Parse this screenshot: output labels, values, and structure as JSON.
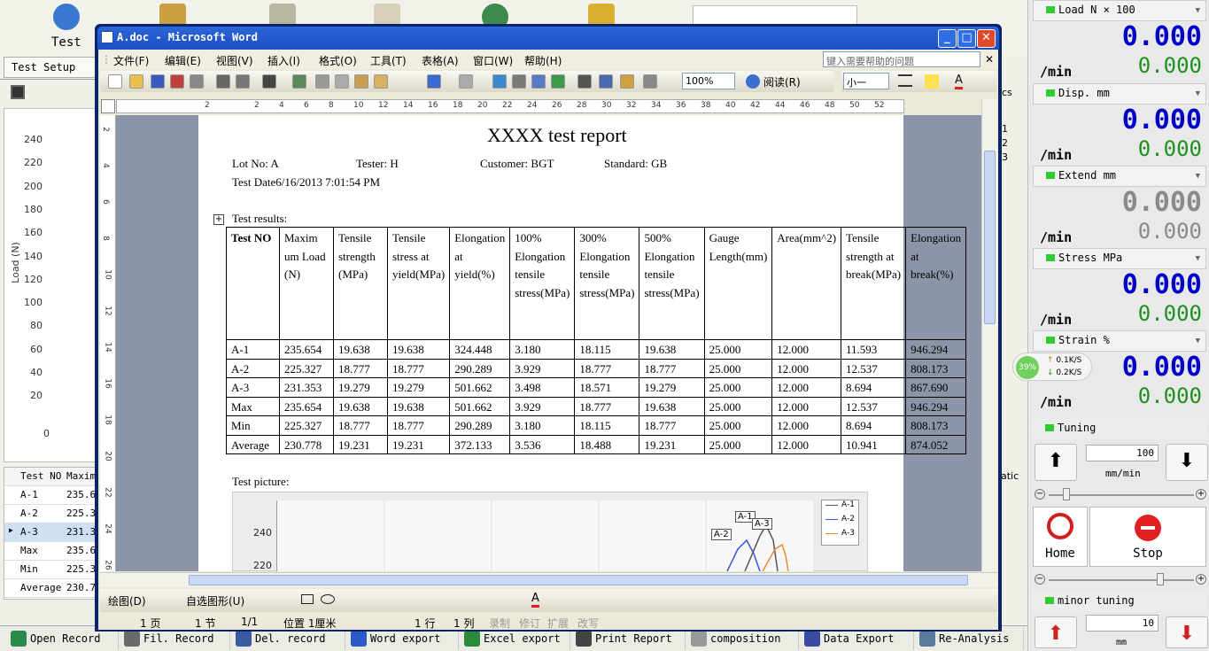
{
  "app": {
    "top_label": "Test",
    "tab_test_setup": "Test Setup",
    "chart_y_ticks": [
      "240",
      "220",
      "200",
      "180",
      "160",
      "140",
      "120",
      "100",
      "80",
      "60",
      "40",
      "20",
      "0"
    ],
    "chart_y_title": "Load (N)",
    "table_headers": [
      "Test NO",
      "Maxim"
    ],
    "table_rows": [
      {
        "no": "A-1",
        "val": "235.65"
      },
      {
        "no": "A-2",
        "val": "225.32"
      },
      {
        "no": "A-3",
        "val": "231.35"
      },
      {
        "no": "Max",
        "val": "235.65"
      },
      {
        "no": "Min",
        "val": "225.32"
      },
      {
        "no": "Average",
        "val": "230.77"
      }
    ],
    "side_numbers": [
      "1",
      "2",
      "3"
    ],
    "cs_text": "cs",
    "atic_text": "atic",
    "bottom_buttons": [
      "Open Record",
      "Fil. Record",
      "Del. record",
      "Word export",
      "Excel export",
      "Print Report",
      "composition",
      "Data Export",
      "Re-Analysis"
    ]
  },
  "right_panel": {
    "channels": [
      {
        "name": "Load N × 100",
        "value": "0.000",
        "rate_unit": "/min",
        "rate": "0.000",
        "active": true
      },
      {
        "name": "Disp. mm",
        "value": "0.000",
        "rate_unit": "/min",
        "rate": "0.000",
        "active": true
      },
      {
        "name": "Extend mm",
        "value": "0.000",
        "rate_unit": "/min",
        "rate": "0.000",
        "active": false
      },
      {
        "name": "Stress MPa",
        "value": "0.000",
        "rate_unit": "/min",
        "rate": "0.000",
        "active": true
      },
      {
        "name": "Strain %",
        "value": "0.000",
        "rate_unit": "/min",
        "rate": "0.000",
        "active": true
      }
    ],
    "tuning_label": "Tuning",
    "tuning_value": "100",
    "tuning_unit": "mm/min",
    "home_label": "Home",
    "stop_label": "Stop",
    "minor_tuning_label": "minor tuning",
    "minor_value": "10",
    "minor_unit": "mm",
    "net_badge": {
      "percent": "39%",
      "up": "0.1K/S",
      "down": "0.2K/S"
    }
  },
  "word": {
    "title": "A.doc - Microsoft Word",
    "menu": [
      "文件(F)",
      "编辑(E)",
      "视图(V)",
      "插入(I)",
      "格式(O)",
      "工具(T)",
      "表格(A)",
      "窗口(W)",
      "帮助(H)"
    ],
    "help_placeholder": "键入需要帮助的问题",
    "zoom": "100%",
    "read_label": "阅读(R)",
    "font_size": "小一",
    "ruler_numbers": [
      "2",
      "2",
      "4",
      "6",
      "8",
      "10",
      "12",
      "14",
      "16",
      "18",
      "20",
      "22",
      "24",
      "26",
      "28",
      "30",
      "32",
      "34",
      "36",
      "38",
      "40",
      "42",
      "44",
      "46",
      "48",
      "50",
      "52"
    ],
    "vruler_numbers": [
      "2",
      "4",
      "6",
      "8",
      "10",
      "12",
      "14",
      "16",
      "18",
      "20",
      "22",
      "24",
      "26"
    ],
    "status": {
      "page": "1 页",
      "section": "1 节",
      "pages": "1/1",
      "position": "位置 1厘米",
      "line": "1 行",
      "col": "1 列",
      "rec": "录制",
      "rev": "修订",
      "ext": "扩展",
      "ovr": "改写"
    },
    "draw_label": "绘图(D)",
    "autoshape_label": "自选图形(U)"
  },
  "doc": {
    "title": "XXXX test report",
    "lot": "Lot No: A",
    "tester": "Tester: H",
    "customer": "Customer: BGT",
    "standard": "Standard: GB",
    "test_date": "Test Date6/16/2013 7:01:54 PM",
    "results_label": "Test results:",
    "picture_label": "Test picture:",
    "table_headers": [
      "Test NO",
      "Maxim um Load (N)",
      "Tensile strength (MPa)",
      "Tensile stress at yield(MPa)",
      "Elongation at yield(%)",
      "100% Elongation tensile stress(MPa)",
      "300% Elongation tensile stress(MPa)",
      "500% Elongation tensile stress(MPa)",
      "Gauge Length(mm)",
      "Area(mm^2)",
      "Tensile strength at break(MPa)",
      "Elongation at break(%)"
    ],
    "table_rows": [
      [
        "A-1",
        "235.654",
        "19.638",
        "19.638",
        "324.448",
        "3.180",
        "18.115",
        "19.638",
        "25.000",
        "12.000",
        "11.593",
        "946.294"
      ],
      [
        "A-2",
        "225.327",
        "18.777",
        "18.777",
        "290.289",
        "3.929",
        "18.777",
        "18.777",
        "25.000",
        "12.000",
        "12.537",
        "808.173"
      ],
      [
        "A-3",
        "231.353",
        "19.279",
        "19.279",
        "501.662",
        "3.498",
        "18.571",
        "19.279",
        "25.000",
        "12.000",
        "8.694",
        "867.690"
      ],
      [
        "Max",
        "235.654",
        "19.638",
        "19.638",
        "501.662",
        "3.929",
        "18.777",
        "19.638",
        "25.000",
        "12.000",
        "12.537",
        "946.294"
      ],
      [
        "Min",
        "225.327",
        "18.777",
        "18.777",
        "290.289",
        "3.180",
        "18.115",
        "18.777",
        "25.000",
        "12.000",
        "8.694",
        "808.173"
      ],
      [
        "Average",
        "230.778",
        "19.231",
        "19.231",
        "372.133",
        "3.536",
        "18.488",
        "19.231",
        "25.000",
        "12.000",
        "10.941",
        "874.052"
      ]
    ],
    "picture": {
      "y_ticks": [
        "240",
        "220"
      ],
      "legend": [
        "A-1",
        "A-2",
        "A-3"
      ],
      "legend_colors": [
        "#555555",
        "#3355dd",
        "#ee8833"
      ],
      "callouts": [
        "A-1",
        "A-2",
        "A-3"
      ]
    }
  }
}
